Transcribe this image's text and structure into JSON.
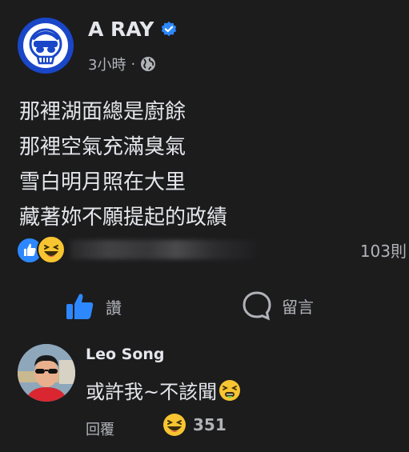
{
  "post": {
    "author": "A RAY",
    "time": "3小時",
    "separator": "·",
    "lines": [
      "那裡湖面總是廚餘",
      "那裡空氣充滿臭氣",
      "雪白明月照在大里",
      "藏著妳不願提起的政績"
    ]
  },
  "reactions": {
    "comment_count": "103則"
  },
  "actions": {
    "like_label": "讚",
    "comment_label": "留言"
  },
  "comment": {
    "author": "Leo Song",
    "text": "或許我~不該聞",
    "reply_label": "回覆",
    "reaction_count": "351"
  },
  "colors": {
    "background": "#1c1c1d",
    "accent": "#2d88ff",
    "haha": "#f7c531"
  }
}
